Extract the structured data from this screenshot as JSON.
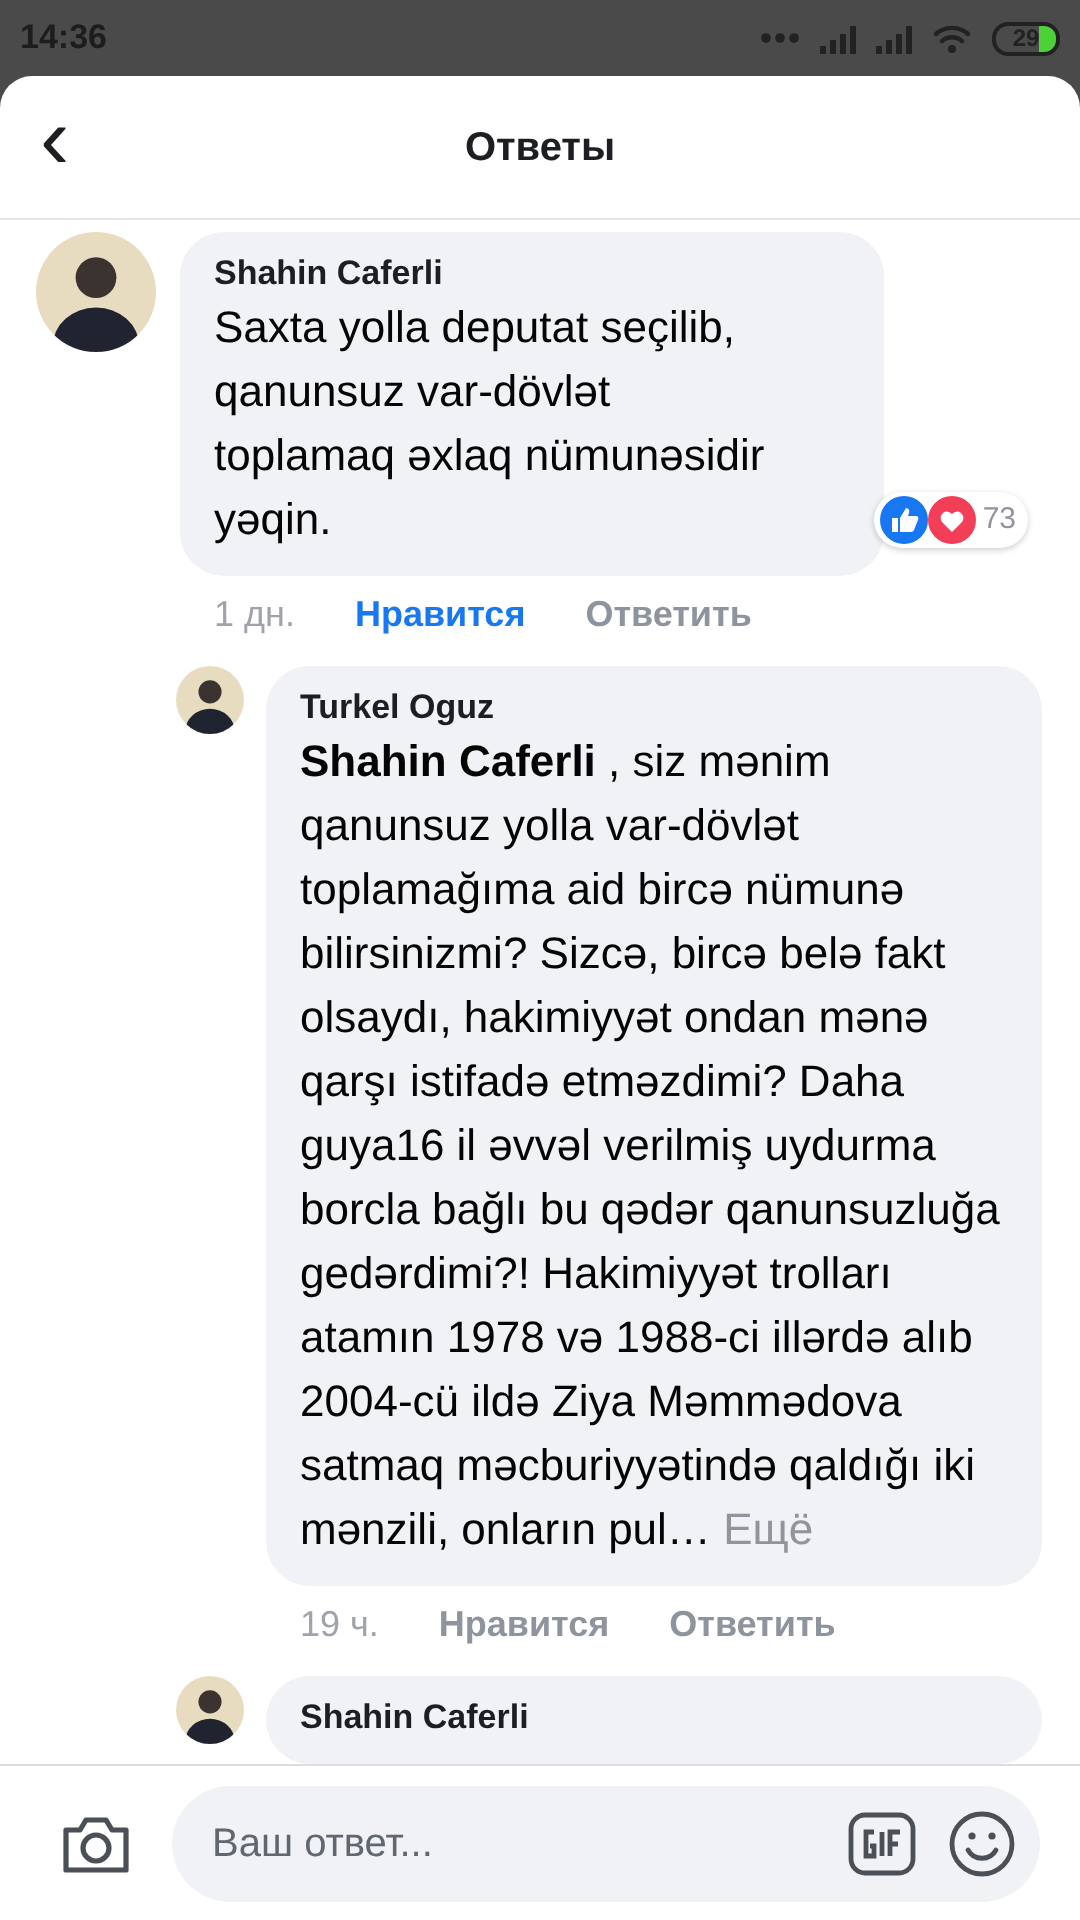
{
  "status_bar": {
    "time": "14:36",
    "battery": "29"
  },
  "header": {
    "back": "‹",
    "title": "Ответы"
  },
  "comments": [
    {
      "author": "Shahin Caferli",
      "kind": "comment",
      "text": "Saxta yolla deputat seçilib, qanunsuz var-dövlət toplamaq əxlaq nümunəsidir yəqin.",
      "reactions": {
        "count": "73"
      },
      "time": "1 дн.",
      "like": "Нравится",
      "liked": true,
      "reply": "Ответить"
    },
    {
      "author": "Turkel Oguz",
      "kind": "reply",
      "text": "**Shahin Caferli** , siz mənim qanunsuz yolla var-dövlət toplamağıma aid bircə nümunə bilirsinizmi? Sizcə, bircə belə fakt olsaydı, hakimiyyət ondan mənə qarşı istifadə etməzdimi? Daha guya16 il əvvəl verilmiş uydurma borcla bağlı bu qədər qanunsuzluğa gedərdimi?! Hakimiyyət trolları atamın 1978 və 1988-ci illərdə alıb 2004-cü ildə Ziya Məmmədova satmaq məcburiyyətində qaldığı iki mənzili, onların pul…",
      "more": "Ещё",
      "time": "19 ч.",
      "like": "Нравится",
      "liked": false,
      "reply": "Ответить"
    },
    {
      "author": "Shahin Caferli",
      "kind": "reply"
    }
  ],
  "composer": {
    "placeholder": "Ваш ответ..."
  }
}
